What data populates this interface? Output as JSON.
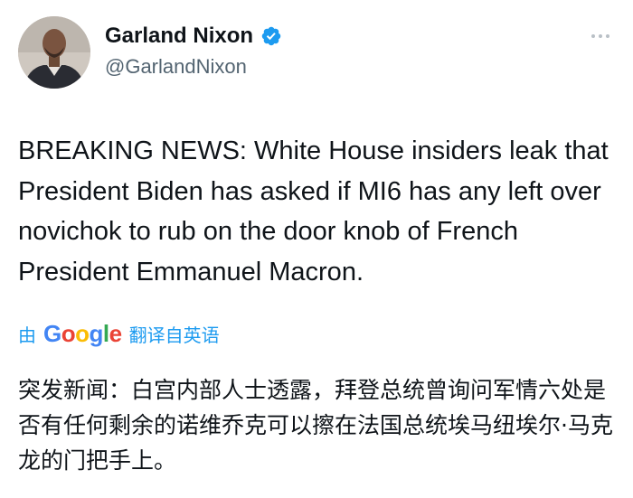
{
  "author": {
    "display_name": "Garland Nixon",
    "handle": "@GarlandNixon"
  },
  "tweet": {
    "text": "BREAKING NEWS: White House insiders leak that President Biden has asked if MI6 has any left over novichok to rub on the door knob of French President Emmanuel Macron."
  },
  "translation": {
    "by_prefix": "由",
    "google_letters": [
      "G",
      "o",
      "o",
      "g",
      "l",
      "e"
    ],
    "google_colors": [
      "#4285f4",
      "#ea4335",
      "#fbbc05",
      "#4285f4",
      "#34a853",
      "#ea4335"
    ],
    "suffix": "翻译自英语",
    "text": "突发新闻：白宫内部人士透露，拜登总统曾询问军情六处是否有任何剩余的诺维乔克可以擦在法国总统埃马纽埃尔·马克龙的门把手上。"
  },
  "icons": {
    "verified": "verified-badge-icon",
    "more": "more-options-icon"
  },
  "colors": {
    "accent": "#1d9bf0",
    "secondary_text": "#536471"
  }
}
